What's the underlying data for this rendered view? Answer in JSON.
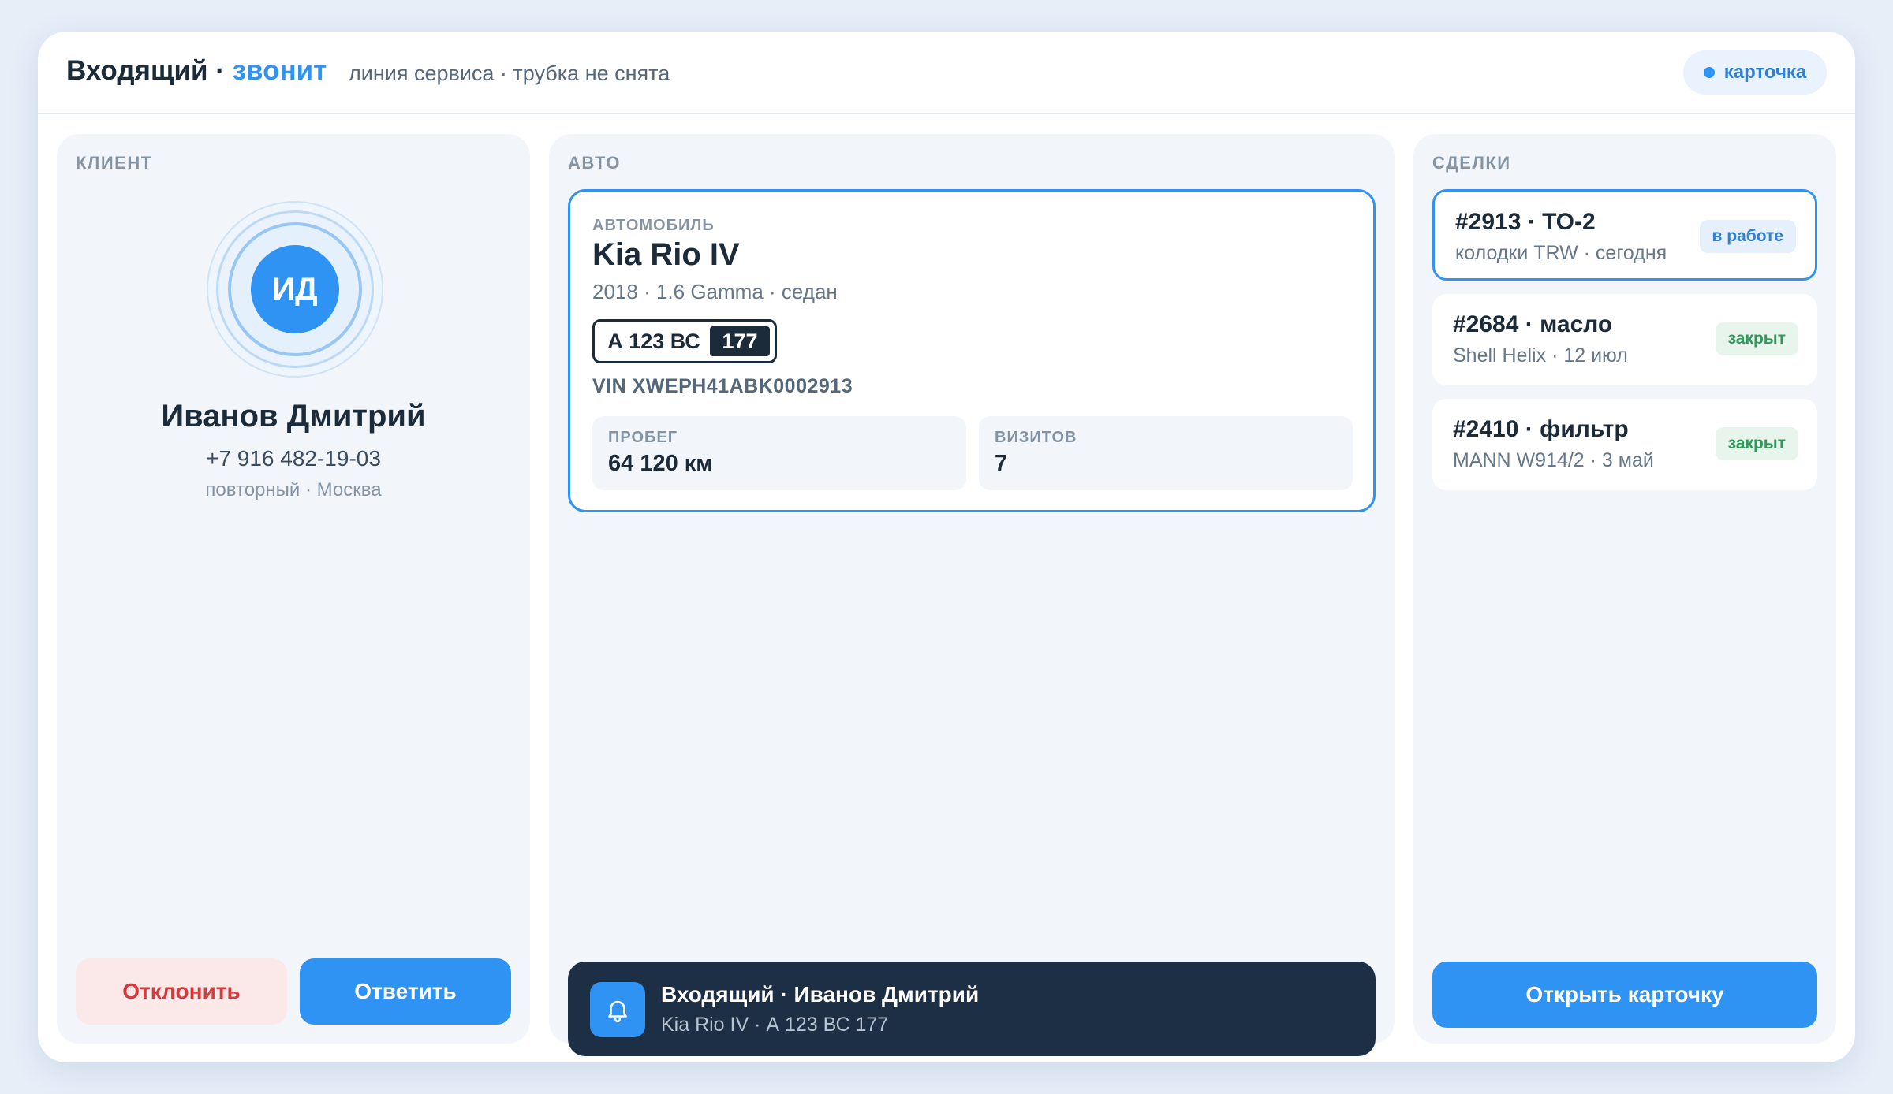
{
  "header": {
    "title_main": "Входящий",
    "title_sep": "·",
    "title_accent": "звонит",
    "subtitle": "линия сервиса · трубка не снята",
    "card_pill": "карточка"
  },
  "client": {
    "section_title": "КЛИЕНТ",
    "initials": "ИД",
    "name": "Иванов Дмитрий",
    "phone": "+7 916 482-19-03",
    "meta": "повторный · Москва",
    "decline_label": "Отклонить",
    "answer_label": "Ответить"
  },
  "car": {
    "section_title": "АВТО",
    "label": "АВТОМОБИЛЬ",
    "model": "Kia Rio IV",
    "spec": "2018 · 1.6 Gamma · седан",
    "plate_number": "А 123 ВС",
    "plate_region": "177",
    "vin": "VIN XWEPH41ABK0002913",
    "stats": [
      {
        "label": "ПРОБЕГ",
        "value": "64 120 км"
      },
      {
        "label": "ВИЗИТОВ",
        "value": "7"
      }
    ]
  },
  "notification": {
    "title": "Входящий · Иванов Дмитрий",
    "subtitle": "Kia Rio IV · А 123 ВС 177",
    "icon": "bell-icon"
  },
  "deals": {
    "section_title": "СДЕЛКИ",
    "items": [
      {
        "title": "#2913 · ТО-2",
        "sub": "колодки TRW · сегодня",
        "status": "в работе"
      },
      {
        "title": "#2684 · масло",
        "sub": "Shell Helix · 12 июл",
        "status": "закрыт"
      },
      {
        "title": "#2410 · фильтр",
        "sub": "MANN W914/2 · 3 май",
        "status": "закрыт"
      }
    ],
    "open_label": "Открыть карточку"
  },
  "colors": {
    "accent": "#2f93f4",
    "dark": "#1c2f44",
    "decline": "#d23c3c",
    "closed": "#2f9a5a"
  }
}
